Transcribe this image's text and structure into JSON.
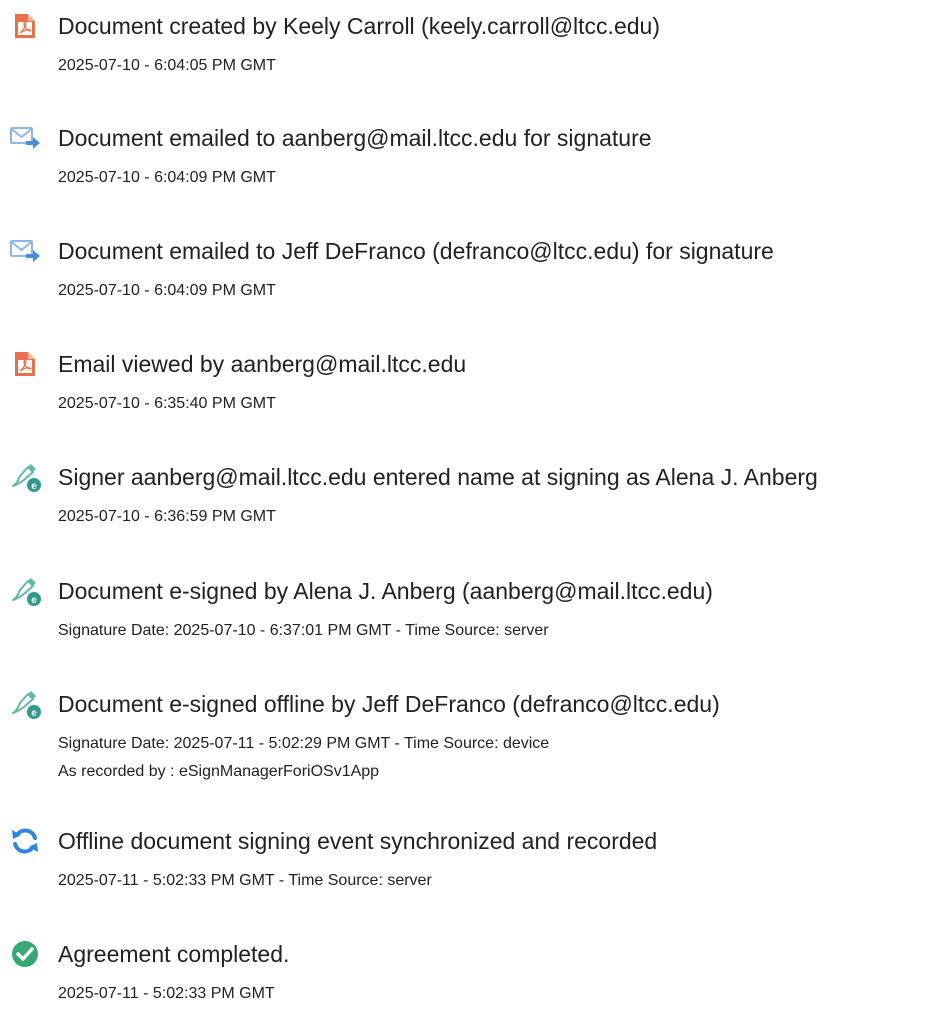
{
  "events": [
    {
      "icon": "document-pdf-icon",
      "title": "Document created by Keely Carroll (keely.carroll@ltcc.edu)",
      "details": [
        "2025-07-10 - 6:04:05 PM GMT"
      ]
    },
    {
      "icon": "email-sent-icon",
      "title": "Document emailed to aanberg@mail.ltcc.edu for signature",
      "details": [
        "2025-07-10 - 6:04:09 PM GMT"
      ]
    },
    {
      "icon": "email-sent-icon",
      "title": "Document emailed to Jeff DeFranco (defranco@ltcc.edu) for signature",
      "details": [
        "2025-07-10 - 6:04:09 PM GMT"
      ]
    },
    {
      "icon": "document-pdf-icon",
      "title": "Email viewed by aanberg@mail.ltcc.edu",
      "details": [
        "2025-07-10 - 6:35:40 PM GMT"
      ]
    },
    {
      "icon": "esign-pen-icon",
      "title": "Signer aanberg@mail.ltcc.edu entered name at signing as Alena J. Anberg",
      "details": [
        "2025-07-10 - 6:36:59 PM GMT"
      ]
    },
    {
      "icon": "esign-pen-icon",
      "title": "Document e-signed by Alena J. Anberg (aanberg@mail.ltcc.edu)",
      "details": [
        "Signature Date: 2025-07-10 - 6:37:01 PM GMT - Time Source: server"
      ]
    },
    {
      "icon": "esign-pen-icon",
      "title": "Document e-signed offline by Jeff DeFranco (defranco@ltcc.edu)",
      "details": [
        "Signature Date: 2025-07-11 - 5:02:29 PM GMT - Time Source: device",
        "As recorded by : eSignManagerForiOSv1App"
      ]
    },
    {
      "icon": "sync-icon",
      "title": "Offline document signing event synchronized and recorded",
      "details": [
        "2025-07-11 - 5:02:33 PM GMT - Time Source: server"
      ]
    },
    {
      "icon": "checkmark-circle-icon",
      "title": "Agreement completed.",
      "details": [
        "2025-07-11 - 5:02:33 PM GMT"
      ]
    }
  ],
  "colors": {
    "text": "#222222",
    "pdf_icon": "#e8714a",
    "email_icon": "#5b9bd5",
    "esign_icon": "#3fae9b",
    "sync_icon": "#2e86de",
    "complete_icon": "#36a871"
  }
}
